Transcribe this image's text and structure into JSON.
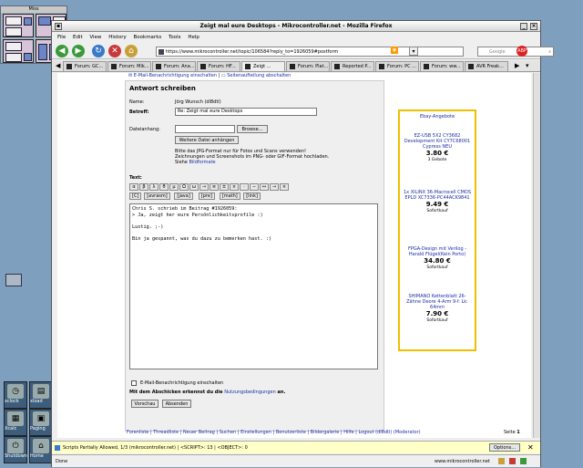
{
  "desktop": {
    "pager_title": "Miss",
    "dock": [
      {
        "label": "xclock",
        "icon": "clock-icon"
      },
      {
        "label": "xload",
        "icon": "chart-icon"
      },
      {
        "label": "Xcalc",
        "icon": "calculator-icon"
      },
      {
        "label": "Paging",
        "icon": "pager-icon"
      },
      {
        "label": "Shutdown",
        "icon": "power-icon"
      },
      {
        "label": "Home",
        "icon": "home-icon"
      }
    ]
  },
  "window": {
    "title": "Zeigt mal eure Desktops - Mikrocontroller.net - Mozilla Firefox",
    "menu": [
      "File",
      "Edit",
      "View",
      "History",
      "Bookmarks",
      "Tools",
      "Help"
    ],
    "url": "https://www.mikrocontroller.net/topic/106584?reply_to=1926059#postform",
    "search_placeholder": "Google",
    "tabs": [
      "Forum: GC...",
      "Forum: Mik...",
      "Forum: Ana...",
      "Forum: HF...",
      "Zeigt ...",
      "Forum: Plat...",
      "Reported P...",
      "Forum: PC ...",
      "Forum: ww...",
      "AVR Freak..."
    ],
    "active_tab": 4
  },
  "page": {
    "top_links": [
      "E-Mail-Benachrichtigung einschalten",
      "Seitenaufteilung abschalten"
    ],
    "form": {
      "heading": "Antwort schreiben",
      "name_label": "Name:",
      "name_value": "Jörg Wunsch (dl8dtl)",
      "subject_label": "Betreff:",
      "subject_value": "Re: Zeigt mal eure Desktops",
      "file_label": "Dateianhang:",
      "browse_label": "Browse...",
      "more_files_label": "Weitere Datei anhängen",
      "note_line1": "Bitte das JPG-Format nur für Fotos und Scans verwenden!",
      "note_line2": "Zeichnungen und Screenshots im PNG- oder GIF-Format hochladen.",
      "note_line3_prefix": "Siehe",
      "note_line3_link": "Bildformate",
      "text_label": "Text:",
      "greek_buttons": [
        "α",
        "β",
        "λ",
        "θ",
        "μ",
        "Ω",
        "ω",
        "→",
        "≡",
        "±",
        "×",
        "·",
        "−",
        "↔",
        "→",
        "×"
      ],
      "tag_buttons": [
        "[C]",
        "[avrasm]",
        "[java]",
        "[pre]",
        "[math]",
        "[link]"
      ],
      "body": "Chris S. schrieb im Beitrag #1926059:\n> Ja, zeigt her eure Persönlichkeitsprofile :)\n\nLustig. ;-)\n\nBin ja gespannt, was du dazu zu bemerken hast. :)",
      "checkbox_label": "E-Mail-Benachrichtigung einschalten",
      "agree_prefix": "Mit dem Abschicken erkennst du die",
      "agree_link": "Nutzungsbedingungen",
      "agree_suffix": "an.",
      "preview_label": "Vorschau",
      "submit_label": "Absenden"
    },
    "ebay": {
      "title": "Ebay-Angebote",
      "items": [
        {
          "name": "EZ-USB 5X2 CY3682 Development Kit CY7C68001 Cypress NEU",
          "price": "3.80 €",
          "sub": "3 Gebote"
        },
        {
          "name": "1x XILINX 36-Macrocell CMOS EPLD XC7336-PC44ACK9841",
          "price": "9.49 €",
          "sub": "Sofortkauf"
        },
        {
          "name": "FPGA-Design mit Verilog - Harald Flügel(Kein Porto)",
          "price": "34.80 €",
          "sub": "Sofortkauf"
        },
        {
          "name": "SHIMANO Kettenblatt 26-Zähne Deore 4-Arm 9-f. Lk: 64mm",
          "price": "7.90 €",
          "sub": "Sofortkauf"
        }
      ]
    },
    "footer_links": "Forenliste | Threadliste | Neuer Beitrag | Suchen | Einstellungen | Benutzerliste | Bildergalerie | Hilfe | Logout (dl8dtl) (Moderator)",
    "page_label": "Seite",
    "page_number": "1"
  },
  "status": {
    "scripts": "Scripts Partially Allowed, 1/3 (mikrocontroller.net) | <SCRIPT>: 13 | <OBJECT>: 0",
    "options_label": "Options...",
    "done": "Done",
    "host": "www.mikrocontroller.net"
  }
}
